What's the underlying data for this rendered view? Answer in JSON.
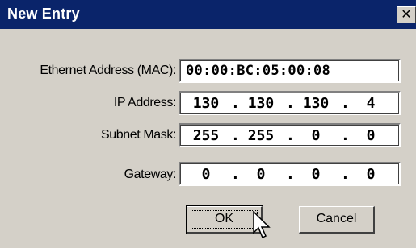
{
  "window": {
    "title": "New Entry",
    "close_glyph": "✕"
  },
  "fields": {
    "mac": {
      "label": "Ethernet Address (MAC):",
      "value": "00:00:BC:05:00:08"
    },
    "ip": {
      "label": "IP Address:",
      "octets": [
        "130",
        "130",
        "130",
        "4"
      ]
    },
    "subnet": {
      "label": "Subnet Mask:",
      "octets": [
        "255",
        "255",
        "0",
        "0"
      ]
    },
    "gateway": {
      "label": "Gateway:",
      "octets": [
        "0",
        "0",
        "0",
        "0"
      ]
    },
    "separator": "."
  },
  "buttons": {
    "ok": "OK",
    "cancel": "Cancel"
  },
  "colors": {
    "titlebar": "#0a246a",
    "face": "#d4d0c8"
  },
  "icons": {
    "close": "close-icon",
    "cursor": "mouse-pointer-icon"
  }
}
